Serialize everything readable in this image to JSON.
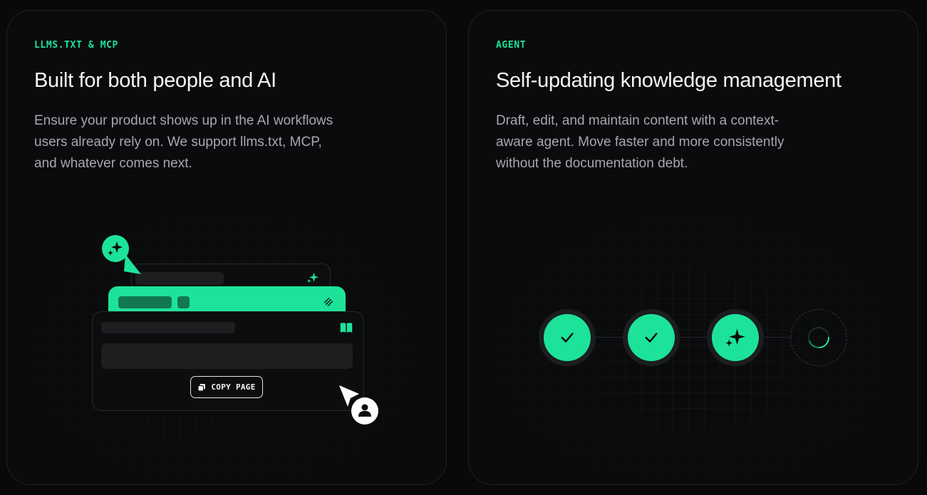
{
  "cards": {
    "left": {
      "eyebrow": "LLMS.TXT & MCP",
      "title": "Built for both people and AI",
      "description": "Ensure your product shows up in the AI workflows users already rely on. We support llms.txt, MCP, and whatever comes next.",
      "illustration": {
        "copy_button_label": "COPY PAGE",
        "icons": [
          "sparkles-icon",
          "layers-icon",
          "book-open-icon",
          "copy-icon",
          "cursor-arrow-icon",
          "user-icon"
        ]
      }
    },
    "right": {
      "eyebrow": "AGENT",
      "title": "Self-updating knowledge management",
      "description": "Draft, edit, and maintain content with a context-aware agent. Move faster and more consistently without the documentation debt.",
      "steps": [
        {
          "state": "complete",
          "icon": "check-icon"
        },
        {
          "state": "complete",
          "icon": "check-icon"
        },
        {
          "state": "active",
          "icon": "sparkles-icon"
        },
        {
          "state": "pending",
          "icon": "spinner-icon"
        }
      ]
    }
  },
  "colors": {
    "background": "#09090b",
    "card": "#0a0b0c",
    "accent": "#1de39a",
    "accent_dark": "#12784f",
    "title": "#f4f4f5",
    "body_text": "#a6a8ad"
  }
}
